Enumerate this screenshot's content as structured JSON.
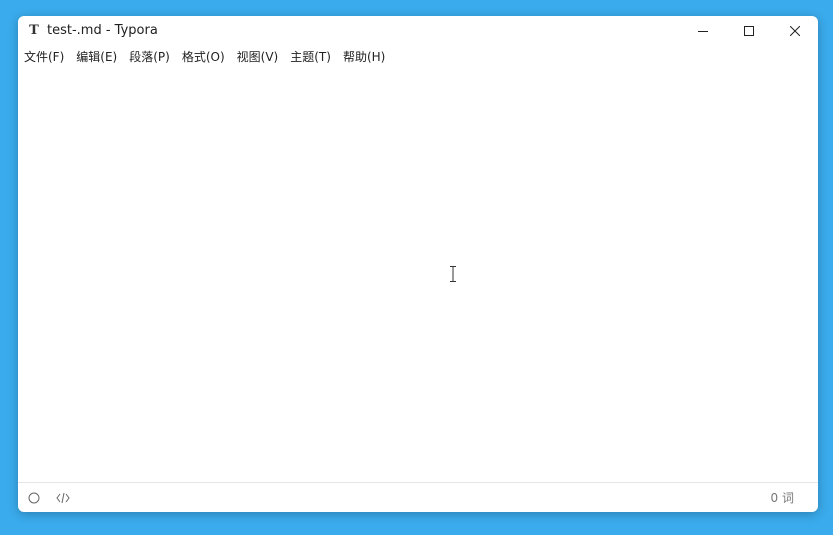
{
  "window": {
    "app_icon_glyph": "T",
    "title": "test-.md - Typora"
  },
  "menu": {
    "items": [
      {
        "label": "文件(F)"
      },
      {
        "label": "编辑(E)"
      },
      {
        "label": "段落(P)"
      },
      {
        "label": "格式(O)"
      },
      {
        "label": "视图(V)"
      },
      {
        "label": "主题(T)"
      },
      {
        "label": "帮助(H)"
      }
    ]
  },
  "statusbar": {
    "outline_icon": "circle-icon",
    "source_icon": "code-icon",
    "word_count": "0 词"
  },
  "colors": {
    "desktop": "#3aabec",
    "window": "#ffffff",
    "text": "#202020"
  }
}
